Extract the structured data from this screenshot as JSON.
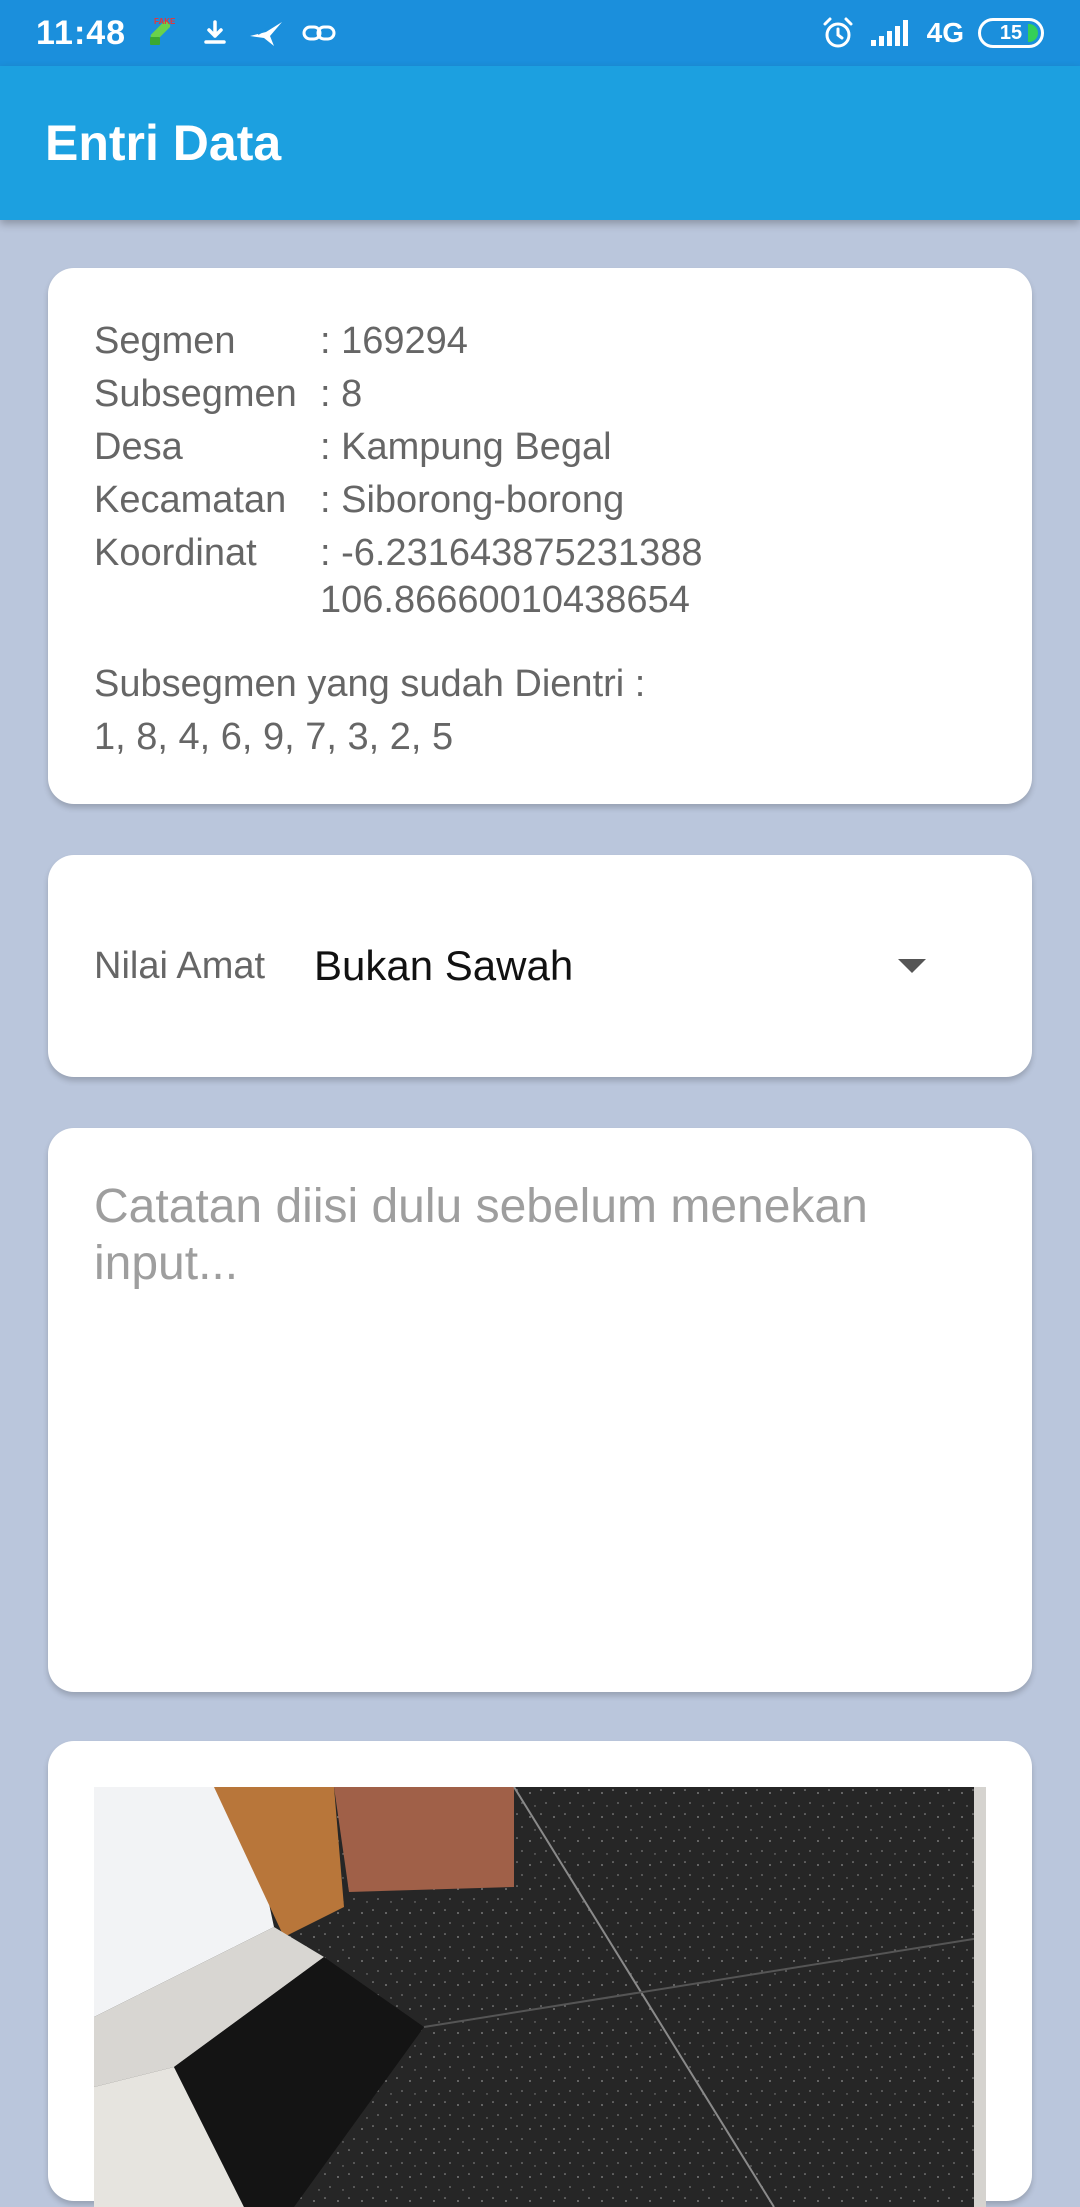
{
  "status_bar": {
    "time": "11:48",
    "network": "4G",
    "battery": "15",
    "icons": [
      "fake-gps-icon",
      "download-icon",
      "bird-icon",
      "link-icon",
      "alarm-icon",
      "signal-icon",
      "battery-icon"
    ]
  },
  "app_bar": {
    "title": "Entri Data"
  },
  "info": {
    "rows": [
      {
        "label": "Segmen",
        "value": ": 169294"
      },
      {
        "label": "Subsegmen",
        "value": ": 8"
      },
      {
        "label": "Desa",
        "value": ": Kampung Begal"
      },
      {
        "label": "Kecamatan",
        "value": ": Siborong-borong"
      },
      {
        "label": "Koordinat",
        "value": ": -6.231643875231388\n  106.86660010438654"
      }
    ],
    "entered_title": "Subsegmen yang sudah Dientri :",
    "entered_list": "1, 8, 4, 6, 9, 7, 3, 2, 5"
  },
  "select": {
    "label": "Nilai Amat",
    "value": "Bukan Sawah"
  },
  "notes": {
    "placeholder": "Catatan diisi dulu sebelum menekan input..."
  },
  "colors": {
    "status_bar": "#1b8fdc",
    "app_bar": "#1ca0e0",
    "background": "#bac6dc"
  }
}
